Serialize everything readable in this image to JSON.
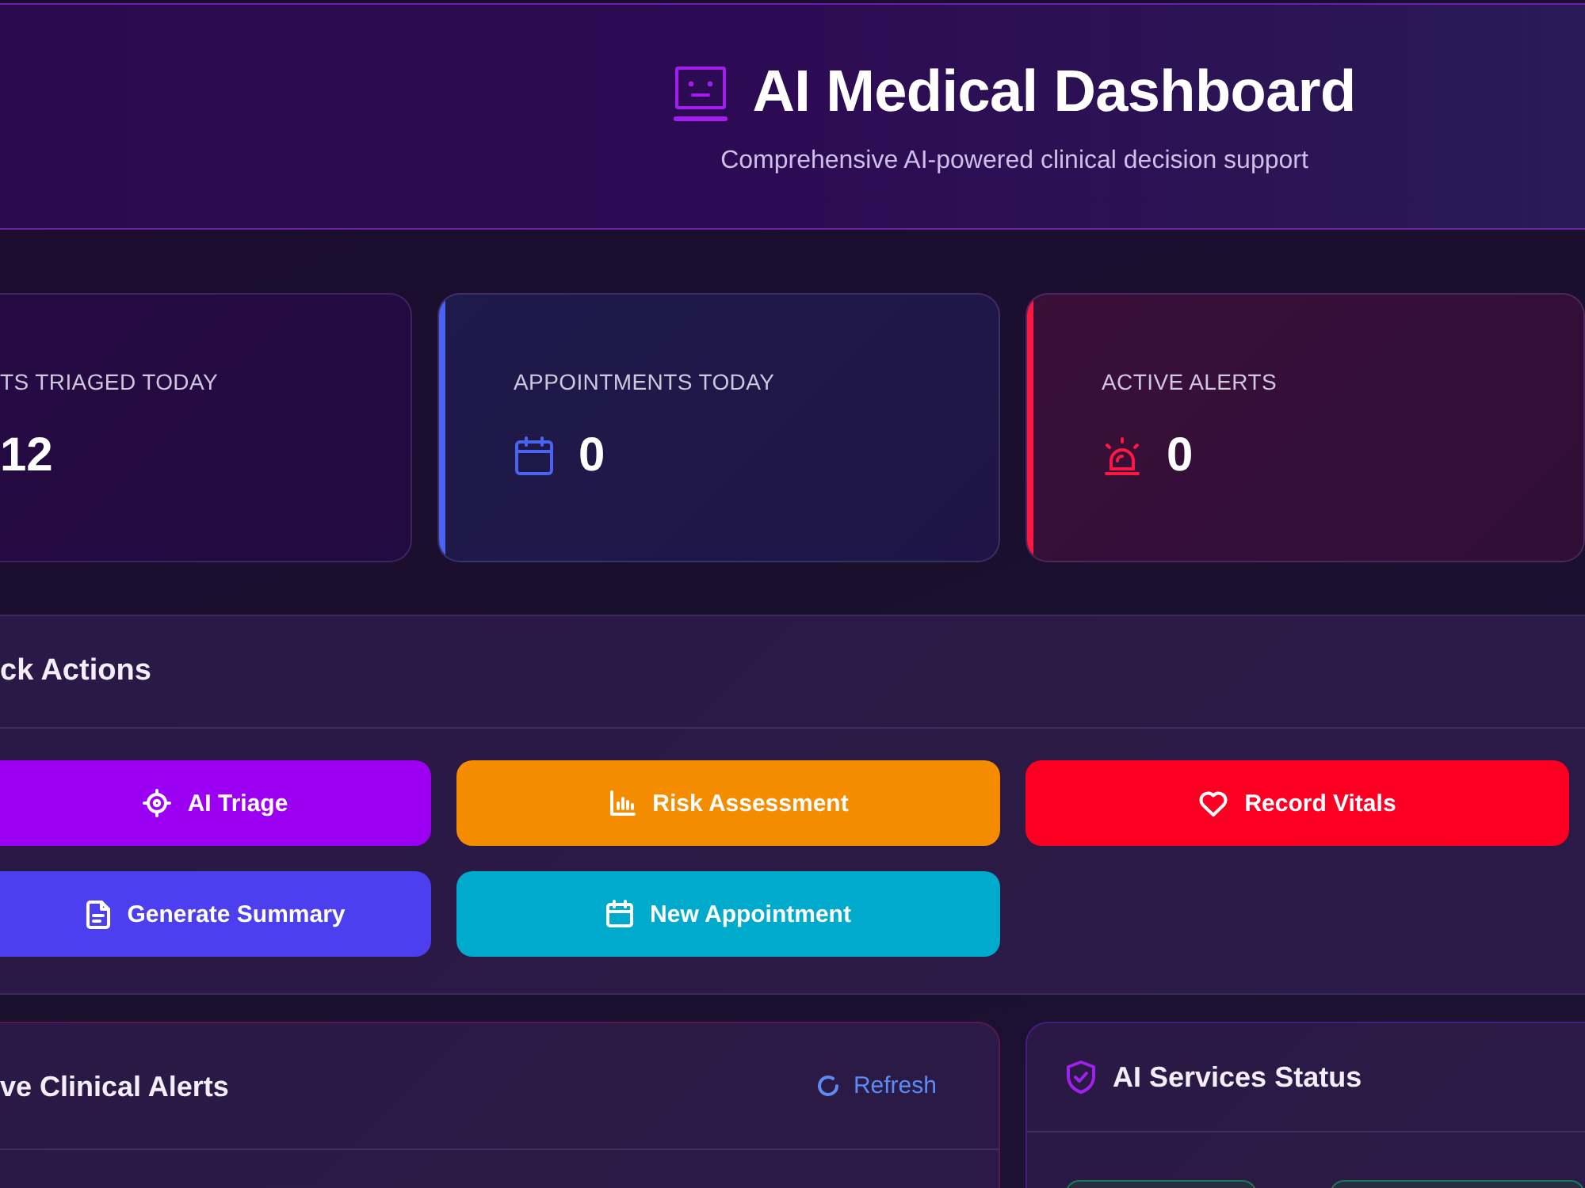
{
  "header": {
    "title": "AI Medical Dashboard",
    "subtitle": "Comprehensive AI-powered clinical decision support"
  },
  "stats": [
    {
      "kind": "triage",
      "label": "TS TRIAGED TODAY",
      "value": "12"
    },
    {
      "kind": "appointments",
      "label": "APPOINTMENTS TODAY",
      "value": "0",
      "color": "#4a63f0"
    },
    {
      "kind": "alerts",
      "label": "ACTIVE ALERTS",
      "value": "0",
      "color": "#ff1744"
    }
  ],
  "quick_actions": {
    "title": "ck Actions",
    "buttons": [
      {
        "kind": "triage",
        "label": "AI Triage",
        "color": "#9c00f2"
      },
      {
        "kind": "risk",
        "label": "Risk Assessment",
        "color": "#f58c00"
      },
      {
        "kind": "vitals",
        "label": "Record Vitals",
        "color": "#fb0022"
      },
      {
        "kind": "summary",
        "label": "Generate Summary",
        "color": "#4c3ff0"
      },
      {
        "kind": "appointment",
        "label": "New Appointment",
        "color": "#00aacc"
      }
    ]
  },
  "alerts_panel": {
    "title": "ve Clinical Alerts",
    "refresh": "Refresh"
  },
  "services_panel": {
    "title": "AI Services Status"
  }
}
